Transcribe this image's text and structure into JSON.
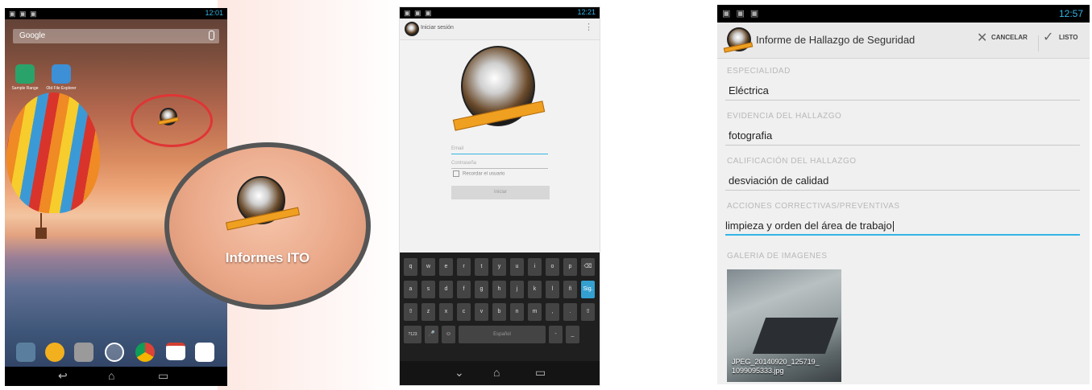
{
  "phone1": {
    "status_time": "12:01",
    "search_label": "Google",
    "app_labels": [
      "Sample Range",
      "Old File Explorer"
    ],
    "app_icon_label": "Informes ITO",
    "magnified_label": "Informes ITO"
  },
  "phone2": {
    "status_time": "12:21",
    "title": "Iniciar sesión",
    "email_placeholder": "Email",
    "password_placeholder": "Contraseña",
    "remember_label": "Recordar el usuario",
    "signin_label": "Iniciar",
    "keyboard": {
      "row1": [
        "q",
        "w",
        "e",
        "r",
        "t",
        "y",
        "u",
        "i",
        "o",
        "p",
        "⌫"
      ],
      "row2": [
        "a",
        "s",
        "d",
        "f",
        "g",
        "h",
        "j",
        "k",
        "l",
        "ñ",
        "Sig."
      ],
      "row3": [
        "⇧",
        "z",
        "x",
        "c",
        "v",
        "b",
        "n",
        "m",
        ",",
        ".",
        "⇧"
      ],
      "row4": [
        "?123",
        "🎤",
        "☺",
        "Español",
        "-",
        "_"
      ]
    }
  },
  "phone3": {
    "status_time": "12:57",
    "title": "Informe de Hallazgo de Seguridad",
    "cancel_label": "CANCELAR",
    "done_label": "LISTO",
    "fields": [
      {
        "label": "ESPECIALIDAD",
        "value": "Eléctrica"
      },
      {
        "label": "EVIDENCIA DEL HALLAZGO",
        "value": "fotografia"
      },
      {
        "label": "CALIFICACIÓN DEL HALLAZGO",
        "value": "desviación de calidad"
      },
      {
        "label": "ACCIONES CORRECTIVAS/PREVENTIVAS",
        "value": "limpieza y orden del área de trabajo"
      }
    ],
    "gallery_label": "GALERIA DE IMAGENES",
    "image_caption_1": "JPEG_20140920_125719_",
    "image_caption_2": "1099095333.jpg"
  },
  "colors": {
    "accent": "#33b5e5",
    "highlight_circle": "#e03535",
    "logo_band": "#f0a020"
  }
}
